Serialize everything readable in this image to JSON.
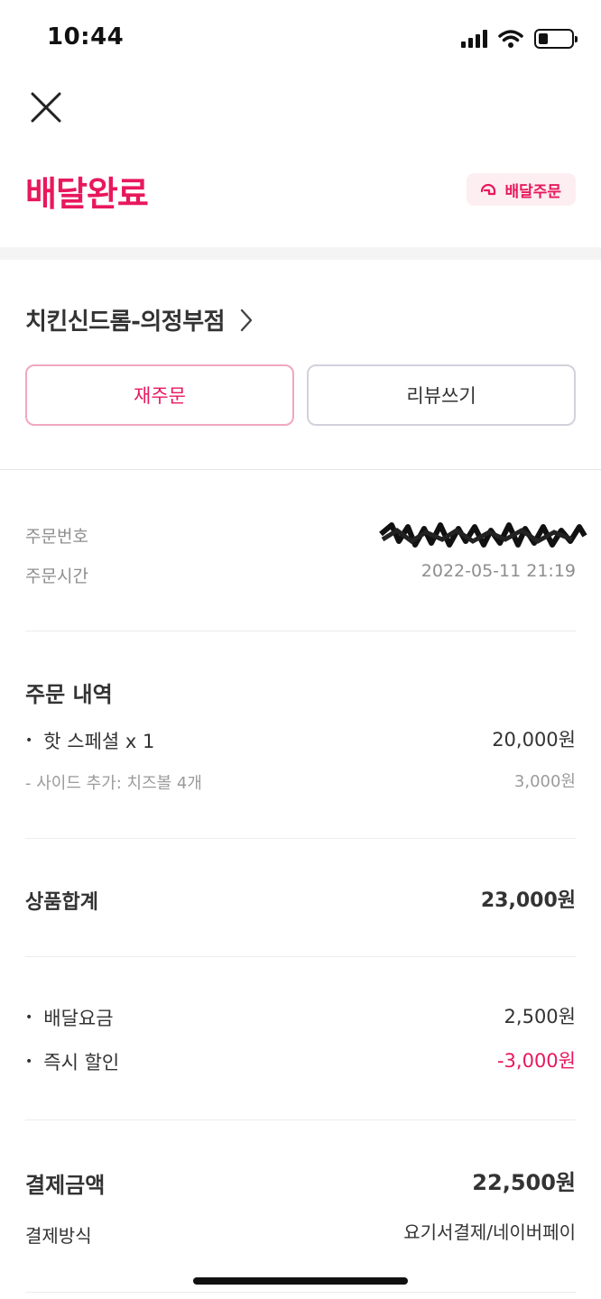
{
  "status_bar": {
    "time": "10:44",
    "battery_level": 0.3
  },
  "header": {
    "title": "배달완료",
    "badge_label": "배달주문",
    "badge_icon": "helmet-icon",
    "accent_color": "#e8185d"
  },
  "store": {
    "name": "치킨신드롬-의정부점"
  },
  "actions": {
    "reorder_label": "재주문",
    "review_label": "리뷰쓰기"
  },
  "order_info": {
    "number_label": "주문번호",
    "time_label": "주문시간",
    "time_value": "2022-05-11 21:19"
  },
  "order_details": {
    "heading": "주문 내역",
    "items": [
      {
        "name": "핫 스페셜 x 1",
        "price": "20,000원",
        "option": "- 사이드 추가: 치즈볼 4개",
        "option_price": "3,000원"
      }
    ]
  },
  "subtotal": {
    "label": "상품합계",
    "value": "23,000원"
  },
  "fees": [
    {
      "label": "배달요금",
      "value": "2,500원"
    },
    {
      "label": "즉시 할인",
      "value": "-3,000원"
    }
  ],
  "payment": {
    "total_label": "결제금액",
    "total_value": "22,500원",
    "method_label": "결제방식",
    "method_value": "요기서결제/네이버페이"
  }
}
